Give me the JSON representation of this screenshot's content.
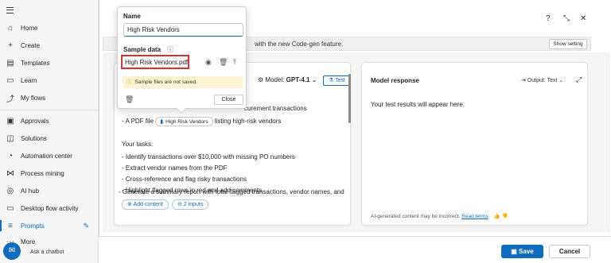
{
  "sidebar": {
    "items": [
      {
        "label": "Home",
        "icon": "home-icon",
        "glyph": "⌂"
      },
      {
        "label": "Create",
        "icon": "plus-icon",
        "glyph": "+"
      },
      {
        "label": "Templates",
        "icon": "templates-icon",
        "glyph": "▤"
      },
      {
        "label": "Learn",
        "icon": "book-icon",
        "glyph": "▭"
      },
      {
        "label": "My flows",
        "icon": "flows-icon",
        "glyph": "⤴"
      },
      {
        "label": "Approvals",
        "icon": "approvals-icon",
        "glyph": "▣"
      },
      {
        "label": "Solutions",
        "icon": "solutions-icon",
        "glyph": "◫"
      },
      {
        "label": "Automation center",
        "icon": "automation-icon",
        "glyph": "◔"
      },
      {
        "label": "Process mining",
        "icon": "process-icon",
        "glyph": "⋈"
      },
      {
        "label": "AI hub",
        "icon": "ai-icon",
        "glyph": "◎"
      },
      {
        "label": "Desktop flow activity",
        "icon": "desktop-icon",
        "glyph": "▭"
      },
      {
        "label": "Prompts",
        "icon": "prompts-icon",
        "glyph": "≡"
      },
      {
        "label": "More",
        "icon": "more-icon",
        "glyph": "⋯"
      }
    ],
    "chatbot_label": "Ask a chatbot"
  },
  "banner": {
    "text": "with the new Code-gen feature.",
    "button": "Show setting"
  },
  "prompt": {
    "line1": "curement transactions",
    "line2_pre": "- A PDF file",
    "line2_chip": "High Risk Vendors",
    "line2_post": "listing high-risk vendors",
    "tasks_header": "Your tasks:",
    "tasks": [
      "- Identify transactions over $10,000 with missing PO numbers",
      "- Extract vendor names from the PDF",
      "- Cross-reference and flag risky transactions",
      "- Highlight flagged rows in red and add comments",
      "- Generate a summary report with total flagged transactions, vendor names, and"
    ],
    "add_content": "Add content",
    "inputs": "2 inputs",
    "model_label": "Model:",
    "model_value": "GPT-4.1",
    "test_label": "Test"
  },
  "response": {
    "title": "Model response",
    "output_label": "Output:",
    "output_value": "Text",
    "placeholder": "Your test results will appear here.",
    "disclaimer": "AI-generated content may be incorrect.",
    "read_terms": "Read terms"
  },
  "popup": {
    "name_label": "Name",
    "name_value": "High Risk Vendors",
    "sample_label": "Sample data",
    "file_name": "High Risk Vendors.pdf",
    "warning": "Sample files are not saved.",
    "close": "Close"
  },
  "footer": {
    "save": "Save",
    "cancel": "Cancel"
  },
  "colors": {
    "accent": "#0f6cbd",
    "highlight_border": "#d13438",
    "warning_bg": "#fdf3d3"
  }
}
